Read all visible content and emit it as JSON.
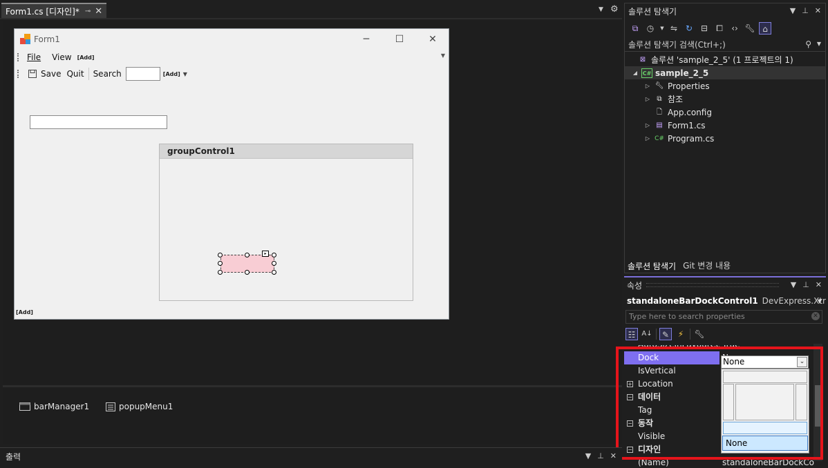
{
  "doc_tab": {
    "title": "Form1.cs [디자인]*",
    "pin": "⊸",
    "close": "✕"
  },
  "form": {
    "title": "Form1",
    "menu": {
      "file": "File",
      "view": "View",
      "add": "[Add]"
    },
    "toolbar": {
      "save": "Save",
      "quit": "Quit",
      "search_label": "Search",
      "add": "[Add]"
    },
    "group_title": "groupControl1",
    "bottom_add": "[Add]"
  },
  "tray": {
    "item1": "barManager1",
    "item2": "popupMenu1"
  },
  "solution_explorer": {
    "title": "솔루션 탐색기",
    "search_placeholder": "솔루션 탐색기 검색(Ctrl+;)",
    "tree": {
      "solution": "솔루션 'sample_2_5' (1 프로젝트의 1)",
      "project": "sample_2_5",
      "properties": "Properties",
      "references": "참조",
      "appconfig": "App.config",
      "form1": "Form1.cs",
      "program": "Program.cs"
    },
    "tabs": {
      "tab1": "솔루션 탐색기",
      "tab2": "Git 변경 내용"
    }
  },
  "properties": {
    "title": "속성",
    "object_name": "standaloneBarDockControl1",
    "object_type": "DevExpress.XtraBa",
    "search_placeholder": "Type here to search properties",
    "rows": {
      "autosize_name": "AutoSizeInLayoutConi",
      "autosize_value": "True",
      "dock_name": "Dock",
      "dock_value": "None",
      "isvertical_name": "IsVertical",
      "location_name": "Location",
      "cat_data": "데이터",
      "tag_name": "Tag",
      "cat_behavior": "동작",
      "visible_name": "Visible",
      "cat_design": "디자인",
      "name_name": "(Name)",
      "name_value": "standaloneBarDockCo"
    },
    "dock_option_none": "None"
  },
  "output": {
    "title": "출력"
  }
}
